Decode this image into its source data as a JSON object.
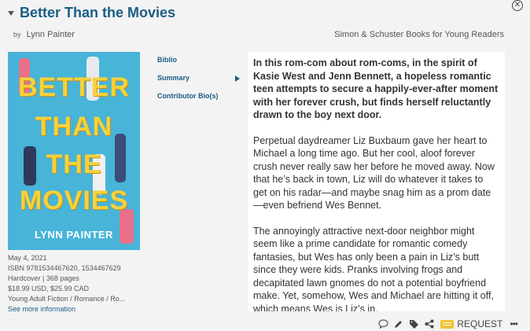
{
  "record": {
    "title": "Better Than the Movies",
    "by_label": "by",
    "author": "Lynn Painter",
    "publisher": "Simon & Schuster Books for Young Readers"
  },
  "cover": {
    "title_lines": [
      "BETTER",
      "THAN",
      "THE",
      "MOVIES"
    ],
    "author": "LYNN PAINTER"
  },
  "meta": {
    "date": "May 4, 2021",
    "isbn": "ISBN 9781534467620, 1534467629",
    "format": "Hardcover | 368 pages",
    "price": "$18.99 USD, $25.99 CAD",
    "genre": "Young Adult Fiction / Romance / Ro...",
    "more_link": "See more information"
  },
  "nav": {
    "items": [
      {
        "label": "Biblio"
      },
      {
        "label": "Summary"
      },
      {
        "label": "Contributor Bio(s)"
      }
    ]
  },
  "summary": {
    "paragraphs": [
      "In this rom-com about rom-coms, in the spirit of Kasie West and Jenn Bennett, a hopeless romantic teen attempts to secure a happily-ever-after moment with her forever crush, but finds herself reluctantly drawn to the boy next door.",
      "Perpetual daydreamer Liz Buxbaum gave her heart to Michael a long time ago. But her cool, aloof forever crush never really saw her before he moved away. Now that he’s back in town, Liz will do whatever it takes to get on his radar—and maybe snag him as a prom date—even befriend Wes Bennet.",
      "The annoyingly attractive next-door neighbor might seem like a prime candidate for romantic comedy fantasies, but Wes has only been a pain in Liz’s butt since they were kids. Pranks involving frogs and decapitated lawn gnomes do not a potential boyfriend make. Yet, somehow, Wes and Michael are hitting it off, which means Wes is Liz’s in."
    ]
  },
  "toolbar": {
    "request_label": "REQUEST",
    "more_label": "•••",
    "icons": [
      "comment-icon",
      "pencil-icon",
      "tags-icon",
      "share-icon",
      "request-icon"
    ]
  },
  "colors": {
    "title": "#1a5d86",
    "cover_bg": "#47b4d8",
    "cover_title": "#f6d23a",
    "request_accent": "#f1c232",
    "panel_bg": "#f3f3f3"
  }
}
